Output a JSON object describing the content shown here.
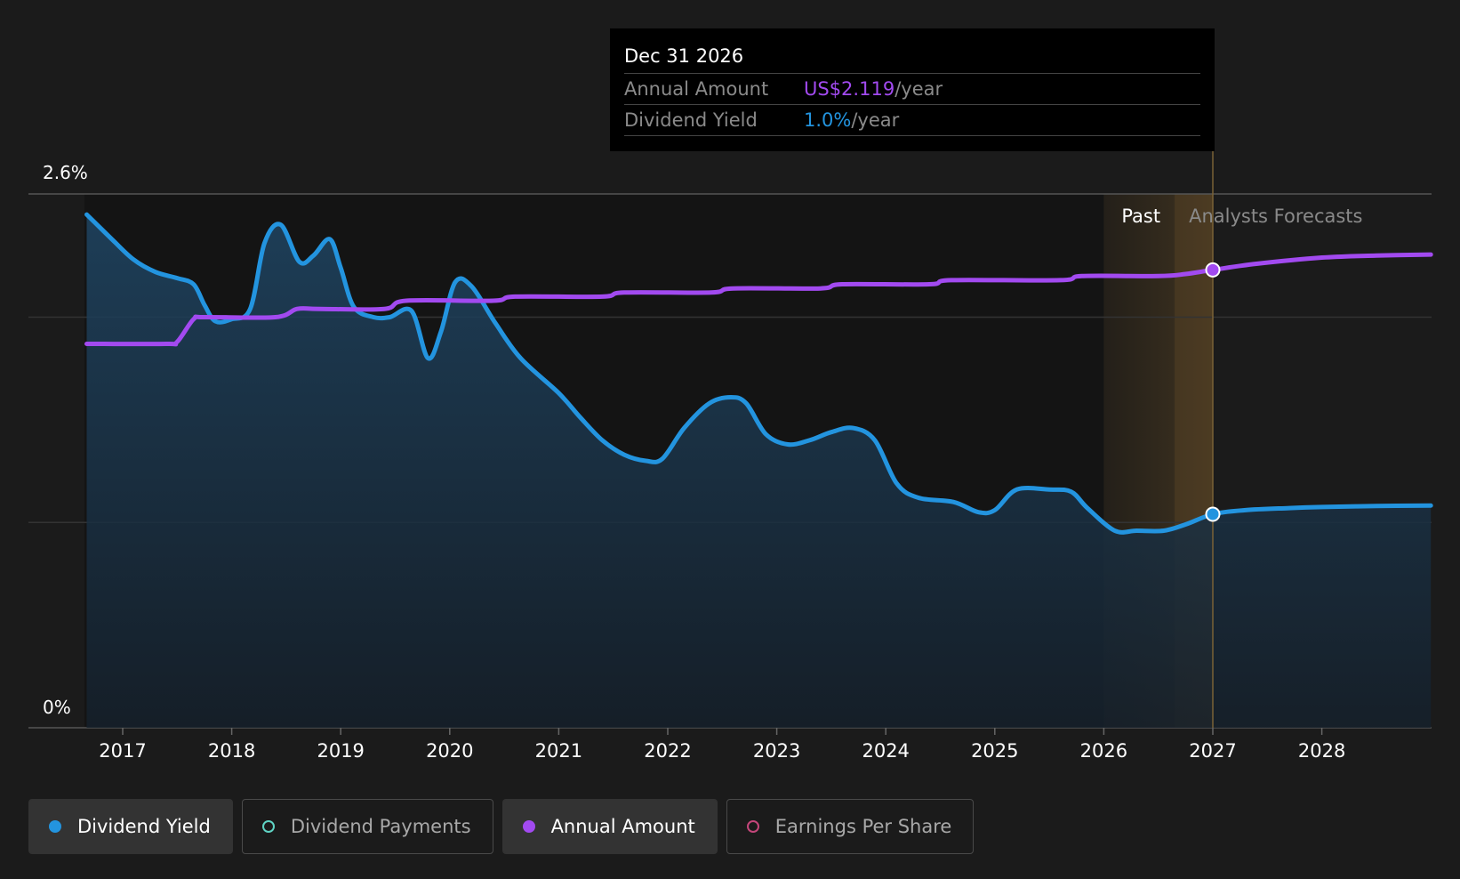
{
  "chart_data": {
    "type": "line",
    "y_axis": {
      "top_label": "2.6%",
      "bottom_label": "0%",
      "ylim": [
        0,
        2.6
      ]
    },
    "x_ticks": [
      "2017",
      "2018",
      "2019",
      "2020",
      "2021",
      "2022",
      "2023",
      "2024",
      "2025",
      "2026",
      "2027",
      "2028"
    ],
    "xlim": [
      2016.65,
      2029.0
    ],
    "gridlines": [
      2.6,
      2.0,
      1.0
    ],
    "regions": {
      "past_label": "Past",
      "forecast_label": "Analysts Forecasts",
      "highlight_start": 2026.0,
      "highlight_split": 2026.65,
      "marker_x": 2027.0
    },
    "series": [
      {
        "name": "Dividend Yield",
        "color": "#2394df",
        "area": true,
        "points": [
          [
            2016.67,
            2.5
          ],
          [
            2016.9,
            2.38
          ],
          [
            2017.1,
            2.28
          ],
          [
            2017.3,
            2.22
          ],
          [
            2017.5,
            2.19
          ],
          [
            2017.65,
            2.16
          ],
          [
            2017.75,
            2.06
          ],
          [
            2017.85,
            1.98
          ],
          [
            2018.0,
            1.99
          ],
          [
            2018.17,
            2.04
          ],
          [
            2018.3,
            2.36
          ],
          [
            2018.45,
            2.45
          ],
          [
            2018.62,
            2.27
          ],
          [
            2018.75,
            2.3
          ],
          [
            2018.9,
            2.38
          ],
          [
            2019.0,
            2.24
          ],
          [
            2019.12,
            2.05
          ],
          [
            2019.3,
            2.0
          ],
          [
            2019.45,
            2.0
          ],
          [
            2019.65,
            2.03
          ],
          [
            2019.8,
            1.8
          ],
          [
            2019.92,
            1.93
          ],
          [
            2020.05,
            2.17
          ],
          [
            2020.2,
            2.15
          ],
          [
            2020.42,
            1.97
          ],
          [
            2020.65,
            1.8
          ],
          [
            2021.0,
            1.63
          ],
          [
            2021.2,
            1.51
          ],
          [
            2021.4,
            1.4
          ],
          [
            2021.6,
            1.33
          ],
          [
            2021.8,
            1.3
          ],
          [
            2021.95,
            1.31
          ],
          [
            2022.15,
            1.46
          ],
          [
            2022.38,
            1.58
          ],
          [
            2022.58,
            1.61
          ],
          [
            2022.72,
            1.58
          ],
          [
            2022.9,
            1.43
          ],
          [
            2023.1,
            1.38
          ],
          [
            2023.3,
            1.4
          ],
          [
            2023.5,
            1.44
          ],
          [
            2023.7,
            1.46
          ],
          [
            2023.9,
            1.4
          ],
          [
            2024.1,
            1.19
          ],
          [
            2024.3,
            1.12
          ],
          [
            2024.62,
            1.1
          ],
          [
            2024.85,
            1.05
          ],
          [
            2025.0,
            1.06
          ],
          [
            2025.2,
            1.16
          ],
          [
            2025.5,
            1.16
          ],
          [
            2025.7,
            1.15
          ],
          [
            2025.85,
            1.07
          ],
          [
            2026.1,
            0.96
          ],
          [
            2026.3,
            0.96
          ],
          [
            2026.55,
            0.96
          ],
          [
            2026.75,
            0.99
          ],
          [
            2027.0,
            1.04
          ],
          [
            2027.3,
            1.06
          ],
          [
            2027.7,
            1.07
          ],
          [
            2028.0,
            1.075
          ],
          [
            2028.5,
            1.08
          ],
          [
            2029.0,
            1.082
          ]
        ]
      },
      {
        "name": "Annual Amount",
        "color": "#a24af0",
        "area": false,
        "points": [
          [
            2016.67,
            1.87
          ],
          [
            2017.4,
            1.87
          ],
          [
            2017.5,
            1.88
          ],
          [
            2017.65,
            1.99
          ],
          [
            2017.75,
            2.0
          ],
          [
            2018.4,
            2.0
          ],
          [
            2018.6,
            2.04
          ],
          [
            2018.8,
            2.04
          ],
          [
            2019.4,
            2.04
          ],
          [
            2019.6,
            2.08
          ],
          [
            2020.4,
            2.08
          ],
          [
            2020.6,
            2.1
          ],
          [
            2021.4,
            2.1
          ],
          [
            2021.6,
            2.12
          ],
          [
            2022.4,
            2.12
          ],
          [
            2022.6,
            2.14
          ],
          [
            2023.4,
            2.14
          ],
          [
            2023.6,
            2.16
          ],
          [
            2024.4,
            2.16
          ],
          [
            2024.6,
            2.18
          ],
          [
            2025.6,
            2.18
          ],
          [
            2025.8,
            2.2
          ],
          [
            2026.5,
            2.2
          ],
          [
            2026.75,
            2.21
          ],
          [
            2027.0,
            2.23
          ],
          [
            2027.4,
            2.26
          ],
          [
            2028.0,
            2.29
          ],
          [
            2028.5,
            2.3
          ],
          [
            2029.0,
            2.305
          ]
        ]
      }
    ]
  },
  "tooltip": {
    "date": "Dec 31 2026",
    "rows": [
      {
        "label": "Annual Amount",
        "value": "US$2.119",
        "unit": "/year",
        "color": "#a24af0"
      },
      {
        "label": "Dividend Yield",
        "value": "1.0%",
        "unit": "/year",
        "color": "#2394df"
      }
    ]
  },
  "legend": [
    {
      "label": "Dividend Yield",
      "color": "#2394df",
      "active": true,
      "filled": true
    },
    {
      "label": "Dividend Payments",
      "color": "#5fd3c4",
      "active": false,
      "filled": false
    },
    {
      "label": "Annual Amount",
      "color": "#a24af0",
      "active": true,
      "filled": true
    },
    {
      "label": "Earnings Per Share",
      "color": "#c4467a",
      "active": false,
      "filled": false
    }
  ]
}
